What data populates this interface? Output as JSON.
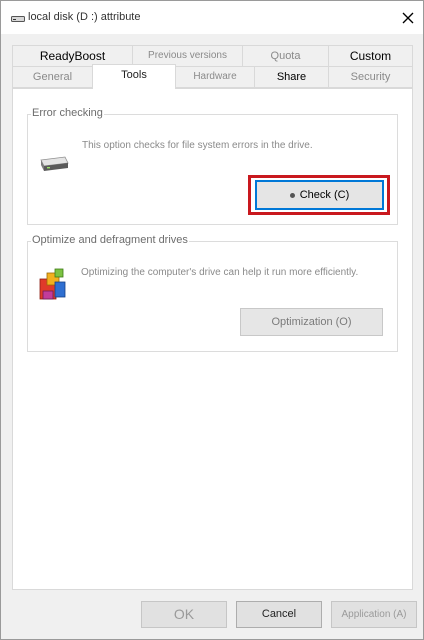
{
  "window": {
    "title": "local disk (D :) attribute",
    "icons": {
      "title": "drive-icon",
      "close": "close-icon"
    }
  },
  "tabs": {
    "row_top": [
      {
        "label": "ReadyBoost",
        "style": "bold"
      },
      {
        "label": "Previous versions",
        "style": "faded"
      },
      {
        "label": "Quota",
        "style": "faded"
      },
      {
        "label": "Custom",
        "style": "bold"
      }
    ],
    "row_bottom": [
      {
        "label": "General",
        "style": "faded"
      },
      {
        "label": "Tools",
        "style": "active"
      },
      {
        "label": "Hardware",
        "style": "faded"
      },
      {
        "label": "Share",
        "style": "bold"
      },
      {
        "label": "Security",
        "style": "faded"
      }
    ]
  },
  "error_checking": {
    "title": "Error checking",
    "description": "This option checks for file system errors in the drive.",
    "button_label": "Check (C)",
    "icon": "hard-drive-icon"
  },
  "optimize": {
    "title": "Optimize and defragment drives",
    "description": "Optimizing the computer's drive can help it run more efficiently.",
    "button_label": "Optimization (O)",
    "icon": "defrag-icon"
  },
  "footer": {
    "ok": "OK",
    "cancel": "Cancel",
    "apply": "Application (A)"
  },
  "colors": {
    "highlight": "#c9181e",
    "focus": "#0078d7"
  }
}
